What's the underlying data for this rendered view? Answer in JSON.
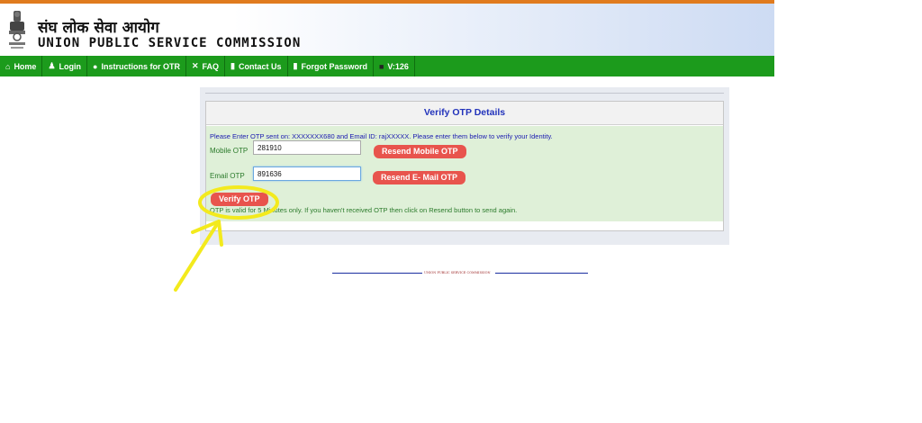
{
  "header": {
    "title_hindi": "संघ लोक सेवा आयोग",
    "title_en": "UNION PUBLIC SERVICE COMMISSION",
    "emblem_icon": "ashoka-emblem-icon"
  },
  "nav": {
    "items": [
      {
        "label": "Home",
        "icon": "home-icon",
        "glyph": "⌂"
      },
      {
        "label": "Login",
        "icon": "user-icon",
        "glyph": "♟"
      },
      {
        "label": "Instructions for OTR",
        "icon": "info-icon",
        "glyph": "●"
      },
      {
        "label": "FAQ",
        "icon": "tools-icon",
        "glyph": "✕"
      },
      {
        "label": "Contact Us",
        "icon": "phone-icon",
        "glyph": "▮"
      },
      {
        "label": "Forgot Password",
        "icon": "phone-icon",
        "glyph": "▮"
      },
      {
        "label": "V:126",
        "icon": "version-icon",
        "glyph": "■"
      }
    ]
  },
  "verify": {
    "heading": "Verify OTP Details",
    "instruction": "Please Enter OTP sent on: XXXXXXX680 and Email ID: rajXXXXX. Please enter them below to verify your Identity.",
    "mobile_label": "Mobile OTP",
    "mobile_value": "281910",
    "resend_mobile": "Resend Mobile OTP",
    "email_label": "Email OTP",
    "email_value": "891636",
    "resend_email": "Resend E- Mail OTP",
    "verify_button": "Verify OTP",
    "note": "OTP is valid for 5 Minutes only. If you haven't received OTP then click on Resend button to send again."
  },
  "footer": {
    "text": "UNION PUBLIC SERVICE COMMISSION"
  },
  "colors": {
    "accent_orange": "#e07b1e",
    "nav_green": "#1c9b1c",
    "button_red": "#e8544d",
    "annotation_yellow": "#f3ea1d",
    "heading_blue": "#2233bb"
  }
}
